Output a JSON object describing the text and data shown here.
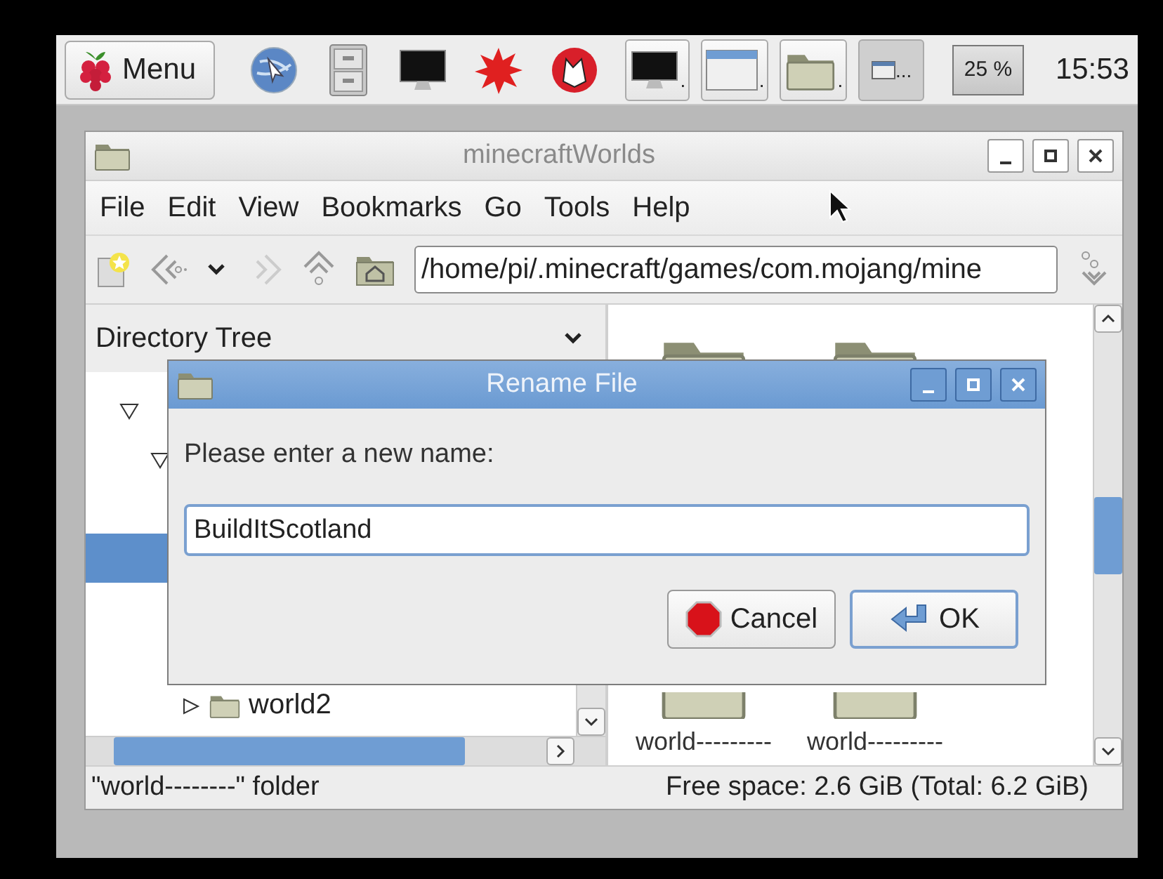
{
  "taskbar": {
    "menu_label": "Menu",
    "tasks": [
      {
        "kind": "monitor",
        "label": ".",
        "selected": false
      },
      {
        "kind": "window",
        "label": ".",
        "selected": false
      },
      {
        "kind": "folder",
        "label": ".",
        "selected": false
      },
      {
        "kind": "small-window",
        "label": "...",
        "selected": true
      }
    ],
    "cpu": "25 %",
    "clock": "15:53"
  },
  "window": {
    "title": "minecraftWorlds",
    "menu": [
      "File",
      "Edit",
      "View",
      "Bookmarks",
      "Go",
      "Tools",
      "Help"
    ],
    "location": "/home/pi/.minecraft/games/com.mojang/mine",
    "sidebar_title": "Directory Tree",
    "tree": [
      {
        "expanded": true,
        "selected": false,
        "children": [
          {
            "expanded": true,
            "selected": false,
            "children": [
              {
                "selected": false
              },
              {
                "selected": true
              },
              {
                "selected": false
              },
              {
                "selected": false
              },
              {
                "label": "world2",
                "expanded": false,
                "selected": false
              }
            ]
          }
        ]
      }
    ],
    "files": [
      {
        "kind": "folder"
      },
      {
        "kind": "folder"
      },
      {
        "kind": "folder",
        "label": "world---------"
      },
      {
        "kind": "folder",
        "label": "world---------"
      }
    ],
    "status_left": "\"world--------\" folder",
    "status_right": "Free space: 2.6 GiB (Total: 6.2 GiB)"
  },
  "dialog": {
    "title": "Rename File",
    "prompt": "Please enter a new name:",
    "value": "BuildItScotland",
    "buttons": [
      {
        "kind": "cancel",
        "label": "Cancel"
      },
      {
        "kind": "ok",
        "label": "OK"
      }
    ]
  }
}
